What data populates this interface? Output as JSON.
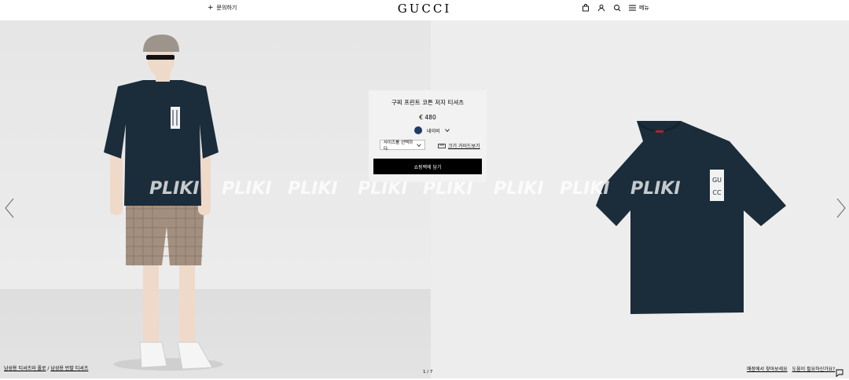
{
  "header": {
    "contact_label": "문의하기",
    "brand": "GUCCI",
    "menu_label": "메뉴"
  },
  "product": {
    "title": "구찌 프린트 코튼 저지 티셔츠",
    "price": "€ 480",
    "color_name": "네이비",
    "color_hex": "#1f3b63",
    "size_placeholder": "사이즈를 선택하다.",
    "size_guide_label": "크기 가이드보기",
    "add_to_cart_label": "쇼핑백에 담기"
  },
  "watermark": {
    "text": "PLIKI"
  },
  "breadcrumb": {
    "item1": "남성용 티셔츠와 폴로",
    "separator": "/",
    "item2": "남성용 반팔 티셔츠"
  },
  "pager": {
    "text": "1 / 7"
  },
  "footer": {
    "store_link": "매장에서 찾아보세요",
    "help_link": "도움이 필요하신가요?"
  },
  "colors": {
    "tshirt": "#1b2c3a",
    "background_left": "#e6e6e6",
    "background_right": "#ededed"
  }
}
